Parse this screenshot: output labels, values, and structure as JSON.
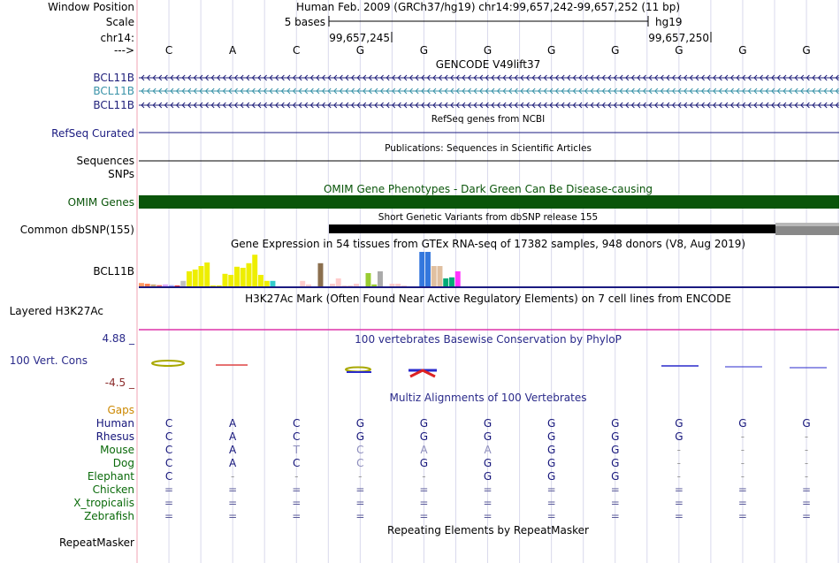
{
  "header": {
    "window_position_label": "Window Position",
    "window_position_value": "Human Feb. 2009 (GRCh37/hg19)   chr14:99,657,242-99,657,252 (11 bp)",
    "scale_label": "Scale",
    "scale_text": "5 bases",
    "assembly": "hg19",
    "chrom_label": "chr14:",
    "coord_left": "99,657,245",
    "coord_right": "99,657,250",
    "arrow_label": "--->"
  },
  "bases": [
    "C",
    "A",
    "C",
    "G",
    "G",
    "G",
    "G",
    "G",
    "G",
    "G",
    "G"
  ],
  "tracks": {
    "gencode": {
      "title": "GENCODE V49lift37",
      "rows": [
        {
          "label": "BCL11B",
          "color": "#1f1f7a"
        },
        {
          "label": "BCL11B",
          "color": "#3a93a8"
        },
        {
          "label": "BCL11B",
          "color": "#1f1f7a"
        }
      ]
    },
    "refseq": {
      "title": "RefSeq genes from NCBI",
      "label": "RefSeq Curated",
      "color": "#1a1a80"
    },
    "publications": {
      "title": "Publications: Sequences in Scientific Articles",
      "label": "Sequences"
    },
    "snps": {
      "label": "SNPs"
    },
    "omim": {
      "title": "OMIM Gene Phenotypes - Dark Green Can Be Disease-causing",
      "label": "OMIM Genes",
      "color": "#0a550a",
      "label_color": "#0a550a"
    },
    "dbsnp": {
      "title": "Short Genetic Variants from dbSNP release 155",
      "label": "Common dbSNP(155)"
    },
    "gtex": {
      "title": "Gene Expression in 54 tissues from GTEx RNA-seq of 17382 samples, 948 donors (V8, Aug 2019)",
      "label": "BCL11B",
      "bars": [
        {
          "v": 0.12,
          "c": "#ff9a66"
        },
        {
          "v": 0.1,
          "c": "#ff7f50"
        },
        {
          "v": 0.08,
          "c": "#c9a87a"
        },
        {
          "v": 0.06,
          "c": "#ff6666"
        },
        {
          "v": 0.08,
          "c": "#d9a6ff"
        },
        {
          "v": 0.06,
          "c": "#a3a3ff"
        },
        {
          "v": 0.05,
          "c": "#ff3333"
        },
        {
          "v": 0.18,
          "c": "#c0c0c0"
        },
        {
          "v": 0.45,
          "c": "#eeee00"
        },
        {
          "v": 0.5,
          "c": "#eeee00"
        },
        {
          "v": 0.6,
          "c": "#eeee00"
        },
        {
          "v": 0.7,
          "c": "#eeee00"
        },
        {
          "v": 0.05,
          "c": "#eeee00"
        },
        {
          "v": 0.05,
          "c": "#eeee00"
        },
        {
          "v": 0.38,
          "c": "#eeee00"
        },
        {
          "v": 0.35,
          "c": "#eeee00"
        },
        {
          "v": 0.58,
          "c": "#eeee00"
        },
        {
          "v": 0.55,
          "c": "#eeee00"
        },
        {
          "v": 0.68,
          "c": "#eeee00"
        },
        {
          "v": 0.92,
          "c": "#eeee00"
        },
        {
          "v": 0.35,
          "c": "#eeee00"
        },
        {
          "v": 0.18,
          "c": "#eeee00"
        },
        {
          "v": 0.18,
          "c": "#33cccc"
        },
        {
          "v": 0.0,
          "c": "#ffffff"
        },
        {
          "v": 0.0,
          "c": "#ffffff"
        },
        {
          "v": 0.0,
          "c": "#ffffff"
        },
        {
          "v": 0.0,
          "c": "#ffffff"
        },
        {
          "v": 0.18,
          "c": "#ffcccc"
        },
        {
          "v": 0.08,
          "c": "#ffcccc"
        },
        {
          "v": 0.0,
          "c": "#ffffff"
        },
        {
          "v": 0.68,
          "c": "#8b6f4e"
        },
        {
          "v": 0.0,
          "c": "#ffffff"
        },
        {
          "v": 0.1,
          "c": "#ffcccc"
        },
        {
          "v": 0.25,
          "c": "#ffcccc"
        },
        {
          "v": 0.05,
          "c": "#ffcccc"
        },
        {
          "v": 0.05,
          "c": "#ffcccc"
        },
        {
          "v": 0.1,
          "c": "#ffcccc"
        },
        {
          "v": 0.0,
          "c": "#ffffff"
        },
        {
          "v": 0.4,
          "c": "#99cc33"
        },
        {
          "v": 0.08,
          "c": "#99cc33"
        },
        {
          "v": 0.45,
          "c": "#aaaaaa"
        },
        {
          "v": 0.0,
          "c": "#ffffff"
        },
        {
          "v": 0.1,
          "c": "#ffcccc"
        },
        {
          "v": 0.1,
          "c": "#ffcccc"
        },
        {
          "v": 0.05,
          "c": "#ffcccc"
        },
        {
          "v": 0.0,
          "c": "#ffffff"
        },
        {
          "v": 0.0,
          "c": "#ffffff"
        },
        {
          "v": 1.0,
          "c": "#3377dd"
        },
        {
          "v": 1.0,
          "c": "#3377dd"
        },
        {
          "v": 0.6,
          "c": "#e0c0a0"
        },
        {
          "v": 0.6,
          "c": "#e0c0a0"
        },
        {
          "v": 0.25,
          "c": "#00aa77"
        },
        {
          "v": 0.28,
          "c": "#00aa77"
        },
        {
          "v": 0.45,
          "c": "#ff33ff"
        }
      ]
    },
    "h3k27ac": {
      "title": "H3K27Ac Mark (Often Found Near Active Regulatory Elements) on 7 cell lines from ENCODE",
      "label": "Layered H3K27Ac"
    },
    "phylop": {
      "title": "100 vertebrates Basewise Conservation by PhyloP",
      "label": "100 Vert. Cons",
      "max": "4.88 _",
      "min": "-4.5 _"
    },
    "multiz": {
      "title": "Multiz Alignments of 100 Vertebrates",
      "gaps_label": "Gaps",
      "species": [
        {
          "name": "Human",
          "color": "#14147a",
          "seq": [
            "C",
            "A",
            "C",
            "G",
            "G",
            "G",
            "G",
            "G",
            "G",
            "G",
            "G"
          ]
        },
        {
          "name": "Rhesus",
          "color": "#14147a",
          "seq": [
            "C",
            "A",
            "C",
            "G",
            "G",
            "G",
            "G",
            "G",
            "G",
            "-",
            "-"
          ]
        },
        {
          "name": "Mouse",
          "color": "#0a6a0a",
          "seq": [
            "C",
            "A",
            "T",
            "C",
            "A",
            "A",
            "G",
            "G",
            "-",
            "-",
            "-"
          ]
        },
        {
          "name": "Dog",
          "color": "#0a6a0a",
          "seq": [
            "C",
            "A",
            "C",
            "C",
            "G",
            "G",
            "G",
            "G",
            "-",
            "-",
            "-"
          ]
        },
        {
          "name": "Elephant",
          "color": "#0a6a0a",
          "seq": [
            "C",
            "-",
            "-",
            "-",
            "-",
            "G",
            "G",
            "G",
            "-",
            "-",
            "-"
          ]
        },
        {
          "name": "Chicken",
          "color": "#0a6a0a",
          "seq": [
            "=",
            "=",
            "=",
            "=",
            "=",
            "=",
            "=",
            "=",
            "=",
            "=",
            "="
          ]
        },
        {
          "name": "X_tropicalis",
          "color": "#0a6a0a",
          "seq": [
            "=",
            "=",
            "=",
            "=",
            "=",
            "=",
            "=",
            "=",
            "=",
            "=",
            "="
          ]
        },
        {
          "name": "Zebrafish",
          "color": "#0a6a0a",
          "seq": [
            "=",
            "=",
            "=",
            "=",
            "=",
            "=",
            "=",
            "=",
            "=",
            "=",
            "="
          ]
        }
      ]
    },
    "repeatmasker": {
      "title": "Repeating Elements by RepeatMasker",
      "label": "RepeatMasker"
    }
  },
  "colors": {
    "divider": "#f2a3b3",
    "grid": "#d9d9ec",
    "h3k27ac": "#dd33aa",
    "phylop_label": "#2a2a8a",
    "gaps": "#cc8800",
    "base_faint": "#8c8cbc"
  }
}
